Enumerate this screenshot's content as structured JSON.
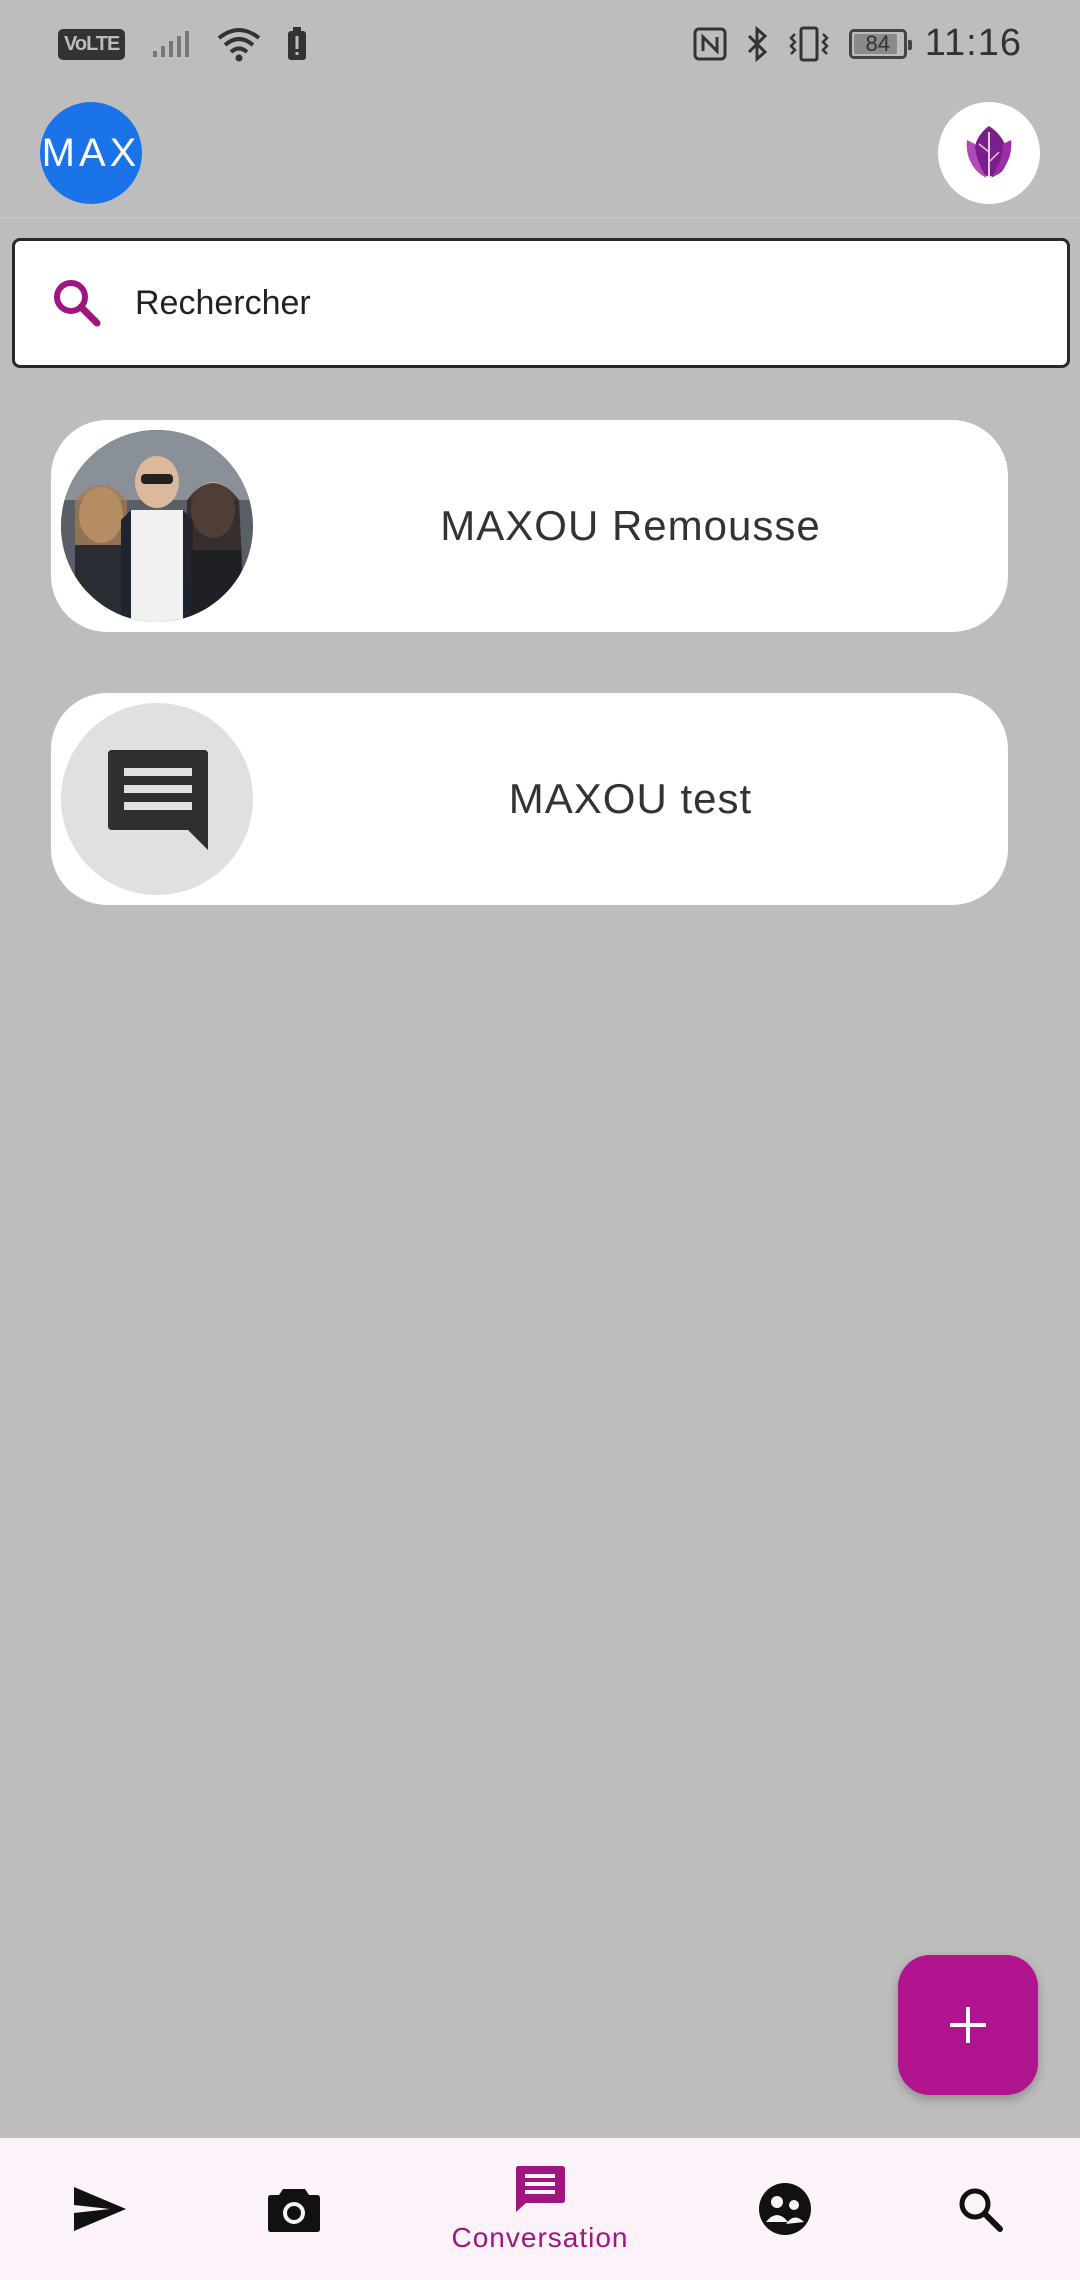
{
  "status_bar": {
    "network_badge": "VoLTE",
    "battery_level": "84",
    "time": "11:16",
    "icons_left": [
      "volte-icon",
      "cell-signal-icon",
      "wifi-icon",
      "battery-alert-icon"
    ],
    "icons_right": [
      "nfc-icon",
      "bluetooth-icon",
      "vibrate-icon",
      "battery-icon"
    ]
  },
  "header": {
    "avatar_text": "MAX",
    "avatar_color": "#1a73e8",
    "logo_icon": "leaf-logo-icon"
  },
  "search": {
    "placeholder": "Rechercher",
    "icon": "search-icon",
    "accent_color": "#a0157f"
  },
  "conversations": [
    {
      "name": "MAXOU Remousse",
      "avatar": "photo"
    },
    {
      "name": "MAXOU test",
      "avatar": "chat-bubble-icon"
    }
  ],
  "fab": {
    "icon": "plus-icon",
    "color": "#b0148f"
  },
  "bottom_nav": {
    "active_index": 2,
    "items": [
      {
        "icon": "send-icon",
        "label": ""
      },
      {
        "icon": "camera-icon",
        "label": ""
      },
      {
        "icon": "chat-icon",
        "label": "Conversation"
      },
      {
        "icon": "groups-icon",
        "label": ""
      },
      {
        "icon": "search-icon",
        "label": ""
      }
    ]
  }
}
